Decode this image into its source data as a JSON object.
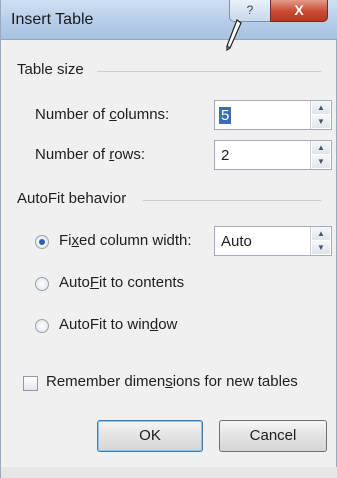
{
  "window": {
    "title": "Insert Table",
    "help_label": "?",
    "close_label": "X"
  },
  "table_size": {
    "section_label": "Table size",
    "columns": {
      "label_pre": "Number of ",
      "label_key": "c",
      "label_post": "olumns:",
      "value": "5"
    },
    "rows": {
      "label_pre": "Number of ",
      "label_key": "r",
      "label_post": "ows:",
      "value": "2"
    }
  },
  "autofit": {
    "section_label": "AutoFit behavior",
    "options": [
      {
        "pre": "Fi",
        "key": "x",
        "post": "ed column width:",
        "checked": true
      },
      {
        "pre": "Auto",
        "key": "F",
        "post": "it to contents",
        "checked": false
      },
      {
        "pre": "AutoFit to win",
        "key": "d",
        "post": "ow",
        "checked": false
      }
    ],
    "fixed_width_value": "Auto"
  },
  "remember": {
    "pre": "Remember dimen",
    "key": "s",
    "post": "ions for new tables",
    "checked": false
  },
  "buttons": {
    "ok_label": "OK",
    "cancel_label": "Cancel"
  },
  "icons": {
    "help": "help-icon",
    "close": "close-icon",
    "spin_up": "chevron-up-icon",
    "spin_down": "chevron-down-icon",
    "cursor": "pen-cursor-icon"
  },
  "colors": {
    "titlebar": "#b6cde8",
    "close_button": "#c94a33",
    "selection": "#3a6fb7",
    "radio_dot": "#2a5fae",
    "dialog_bg": "#f0f0f0"
  }
}
